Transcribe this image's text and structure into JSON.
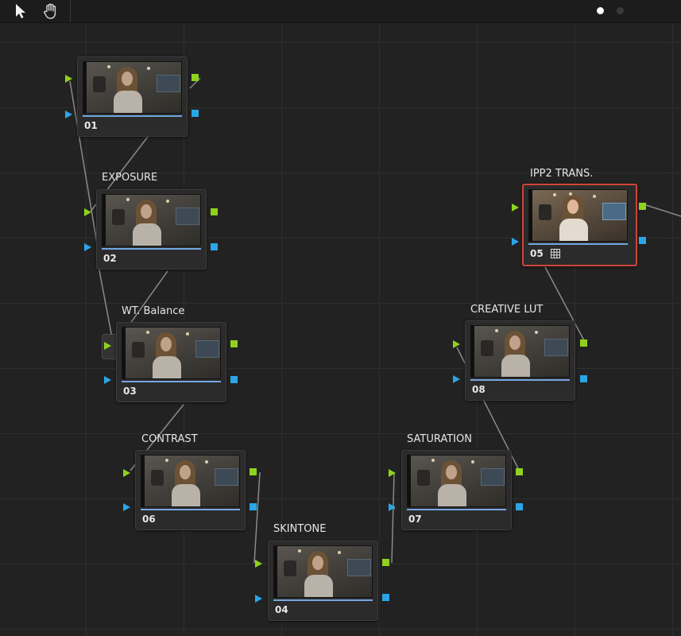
{
  "toolbar": {
    "tools": [
      {
        "name": "pointer-tool",
        "icon": "arrow-cursor-icon"
      },
      {
        "name": "hand-tool",
        "icon": "hand-icon"
      }
    ],
    "pages": [
      {
        "active": true,
        "color": "#ffffff"
      },
      {
        "active": false,
        "color": "#3a3a3a"
      }
    ]
  },
  "colors": {
    "rgb_port": "#8fd11e",
    "key_port": "#2aa6e8",
    "selected_border": "#d0453a",
    "progress_bar": "#74a7e0",
    "link": "#8a8a8a"
  },
  "nodes": [
    {
      "id": "01",
      "number": "01",
      "label": ""
    },
    {
      "id": "02",
      "number": "02",
      "label": "EXPOSURE"
    },
    {
      "id": "03",
      "number": "03",
      "label": "WT. Balance"
    },
    {
      "id": "06",
      "number": "06",
      "label": "CONTRAST"
    },
    {
      "id": "04",
      "number": "04",
      "label": "SKINTONE"
    },
    {
      "id": "07",
      "number": "07",
      "label": "SATURATION"
    },
    {
      "id": "08",
      "number": "08",
      "label": "CREATIVE LUT"
    },
    {
      "id": "05",
      "number": "05",
      "label": "IPP2 TRANS.",
      "selected": true,
      "icon": "lut-grid-icon"
    }
  ]
}
